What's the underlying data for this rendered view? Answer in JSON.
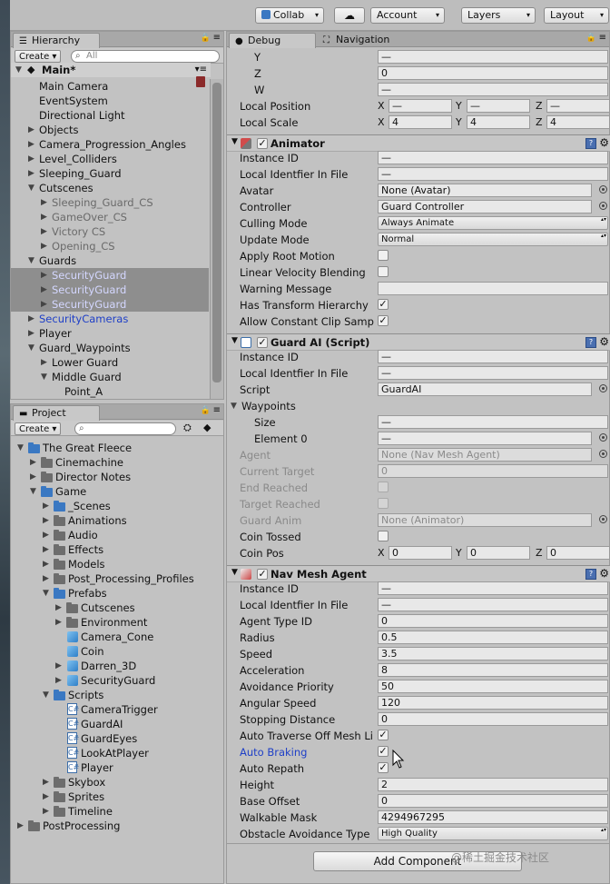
{
  "toolbar": {
    "collab": "Collab",
    "account": "Account",
    "layers": "Layers",
    "layout": "Layout"
  },
  "hierarchy": {
    "tab": "Hierarchy",
    "create": "Create",
    "search_placeholder": "All",
    "scene": "Main*",
    "items": [
      "Main Camera",
      "EventSystem",
      "Directional Light",
      "Objects",
      "Camera_Progression_Angles",
      "Level_Colliders",
      "Sleeping_Guard",
      "Cutscenes",
      "Sleeping_Guard_CS",
      "GameOver_CS",
      "Victory CS",
      "Opening_CS",
      "Guards",
      "SecurityGuard",
      "SecurityGuard",
      "SecurityGuard",
      "SecurityCameras",
      "Player",
      "Guard_Waypoints",
      "Lower Guard",
      "Middle Guard",
      "Point_A"
    ]
  },
  "project": {
    "tab": "Project",
    "create": "Create",
    "items": [
      "The Great Fleece",
      "Cinemachine",
      "Director Notes",
      "Game",
      "_Scenes",
      "Animations",
      "Audio",
      "Effects",
      "Models",
      "Post_Processing_Profiles",
      "Prefabs",
      "Cutscenes",
      "Environment",
      "Camera_Cone",
      "Coin",
      "Darren_3D",
      "SecurityGuard",
      "Scripts",
      "CameraTrigger",
      "GuardAI",
      "GuardEyes",
      "LookAtPlayer",
      "Player",
      "Skybox",
      "Sprites",
      "Timeline",
      "PostProcessing"
    ]
  },
  "inspector": {
    "tabs": [
      "Debug",
      "Navigation"
    ],
    "transform": {
      "y": "Y",
      "z": "Z",
      "w": "W",
      "z_val": "0",
      "local_position": "Local Position",
      "local_scale": "Local Scale",
      "x_label": "X",
      "y_label": "Y",
      "z_label": "Z",
      "scale_x": "4",
      "scale_y": "4",
      "scale_z": "4",
      "dash": "—"
    },
    "animator": {
      "title": "Animator",
      "instance_id": "Instance ID",
      "local_identifier": "Local Identfier In File",
      "avatar": "Avatar",
      "avatar_val": "None (Avatar)",
      "controller": "Controller",
      "controller_val": "Guard Controller",
      "culling_mode": "Culling Mode",
      "culling_val": "Always Animate",
      "update_mode": "Update Mode",
      "update_val": "Normal",
      "apply_root_motion": "Apply Root Motion",
      "linear_velocity": "Linear Velocity Blending",
      "warning": "Warning Message",
      "has_transform": "Has Transform Hierarchy",
      "allow_constant": "Allow Constant Clip Samp"
    },
    "guard_ai": {
      "title": "Guard AI (Script)",
      "instance_id": "Instance ID",
      "local_identifier": "Local Identfier In File",
      "script": "Script",
      "script_val": "GuardAI",
      "waypoints": "Waypoints",
      "size": "Size",
      "element0": "Element 0",
      "agent": "Agent",
      "agent_val": "None (Nav Mesh Agent)",
      "current_target": "Current Target",
      "current_target_val": "0",
      "end_reached": "End Reached",
      "target_reached": "Target Reached",
      "guard_anim": "Guard Anim",
      "guard_anim_val": "None (Animator)",
      "coin_tossed": "Coin Tossed",
      "coin_pos": "Coin Pos",
      "coin_x": "0",
      "coin_y": "0",
      "coin_z": "0"
    },
    "nav_mesh": {
      "title": "Nav Mesh Agent",
      "rows": [
        {
          "label": "Instance ID",
          "value": "—"
        },
        {
          "label": "Local Identfier In File",
          "value": "—"
        },
        {
          "label": "Agent Type ID",
          "value": "0"
        },
        {
          "label": "Radius",
          "value": "0.5"
        },
        {
          "label": "Speed",
          "value": "3.5"
        },
        {
          "label": "Acceleration",
          "value": "8"
        },
        {
          "label": "Avoidance Priority",
          "value": "50"
        },
        {
          "label": "Angular Speed",
          "value": "120"
        },
        {
          "label": "Stopping Distance",
          "value": "0"
        }
      ],
      "auto_traverse": "Auto Traverse Off Mesh Li",
      "auto_braking": "Auto Braking",
      "auto_repath": "Auto Repath",
      "height": "Height",
      "height_val": "2",
      "base_offset": "Base Offset",
      "base_offset_val": "0",
      "walkable_mask": "Walkable Mask",
      "walkable_mask_val": "4294967295",
      "obstacle": "Obstacle Avoidance Type",
      "obstacle_val": "High Quality"
    },
    "add_component": "Add Component"
  },
  "watermark": "@稀土掘金技术社区",
  "colors": {
    "selection": "#8e8e8e",
    "blue_text": "#1e3fc7",
    "panel_bg": "#c2c2c2"
  }
}
